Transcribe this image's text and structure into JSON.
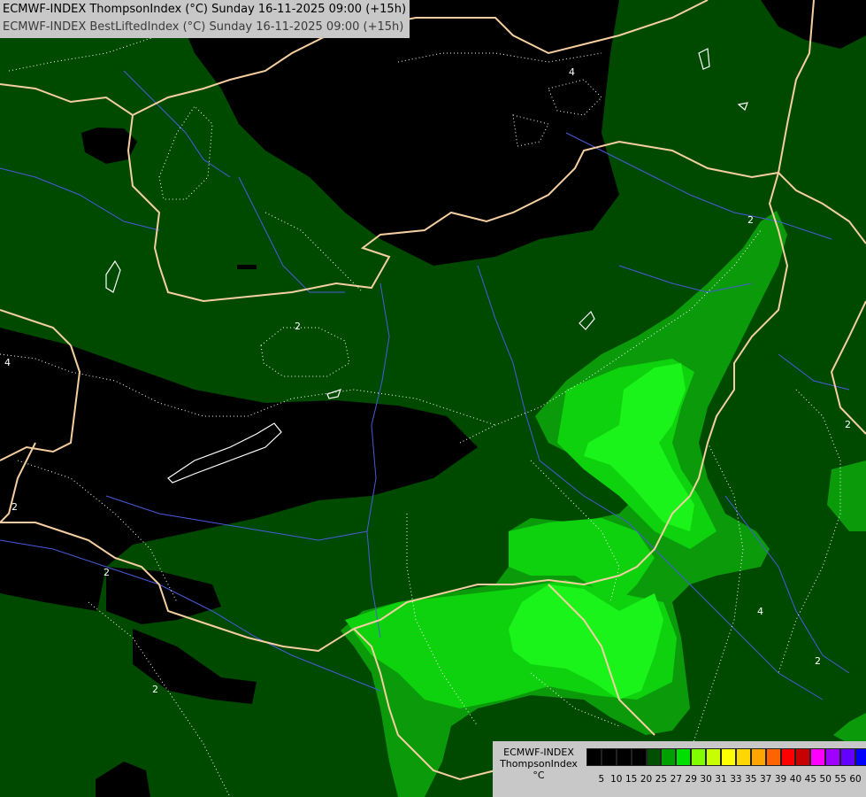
{
  "header": {
    "line1": "ECMWF-INDEX ThompsonIndex (°C) Sunday 16-11-2025 09:00 (+15h)",
    "line2": "ECMWF-INDEX BestLiftedIndex (°C) Sunday 16-11-2025 09:00 (+15h)"
  },
  "legend": {
    "title": "ECMWF-INDEX",
    "parameter": "ThompsonIndex",
    "unit": "°C",
    "ticks": [
      "5",
      "10",
      "15",
      "20",
      "25",
      "27",
      "29",
      "30",
      "31",
      "33",
      "35",
      "37",
      "39",
      "40",
      "45",
      "50",
      "55",
      "60"
    ],
    "colors": [
      "#000000",
      "#000000",
      "#000000",
      "#000000",
      "#005000",
      "#00a000",
      "#00e000",
      "#80ff00",
      "#c8ff00",
      "#ffff00",
      "#ffd700",
      "#ffa500",
      "#ff6400",
      "#ff0000",
      "#c80000",
      "#ff00ff",
      "#a000ff",
      "#6400ff",
      "#0000ff"
    ]
  },
  "contour_labels": [
    "4",
    "4",
    "2",
    "2",
    "2",
    "2",
    "2",
    "2",
    "4",
    "2",
    "2"
  ],
  "colors": {
    "dark_green": "#004a00",
    "mid_green": "#0a9a0a",
    "light_green": "#0fd20f",
    "bright_green": "#18f018",
    "black": "#000000",
    "border": "#f5cfa0",
    "river": "#4a5ad8",
    "contour": "#ffffff"
  }
}
